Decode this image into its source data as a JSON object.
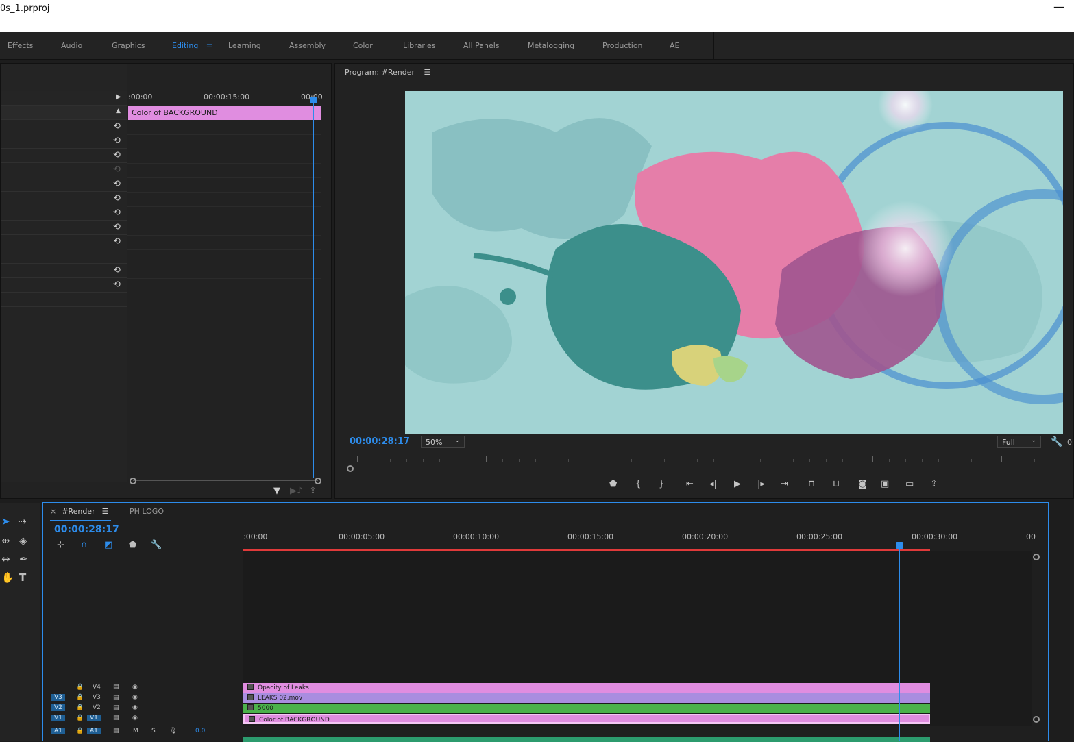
{
  "window": {
    "title": "0s_1.prproj",
    "minimize": "—"
  },
  "workspace_tabs": [
    "Effects",
    "Audio",
    "Graphics",
    "Editing",
    "Learning",
    "Assembly",
    "Color",
    "Libraries",
    "All Panels",
    "Metalogging",
    "Production",
    "AE"
  ],
  "workspace_active": "Editing",
  "effect_controls": {
    "ruler_labels": [
      ":00:00",
      "00:00:15:00",
      "00:00"
    ],
    "clip_label": "Color of BACKGROUND"
  },
  "program_monitor": {
    "title": "Program: #Render",
    "timecode": "00:00:28:17",
    "zoom": "50%",
    "quality": "Full",
    "trailing": "0"
  },
  "timeline": {
    "tabs": [
      {
        "label": "#Render",
        "active": true
      },
      {
        "label": "PH LOGO",
        "active": false
      }
    ],
    "timecode": "00:00:28:17",
    "ruler_labels": [
      ":00:00",
      "00:00:05:00",
      "00:00:10:00",
      "00:00:15:00",
      "00:00:20:00",
      "00:00:25:00",
      "00:00:30:00",
      "00"
    ],
    "tracks": [
      {
        "target": "",
        "name": "V4",
        "clip": "Opacity of Leaks",
        "color": "#e08de0"
      },
      {
        "target": "V3",
        "name": "V3",
        "clip": "LEAKS 02.mov",
        "color": "#a98de0"
      },
      {
        "target": "V2",
        "name": "V2",
        "clip": "5000",
        "color": "#4bb24b"
      },
      {
        "target": "V1",
        "name": "V1",
        "clip": "Color of BACKGROUND",
        "color": "#e08de0"
      }
    ],
    "audio_track": {
      "target": "A1",
      "name": "A1",
      "mute": "M",
      "solo": "S",
      "volume": "0.0"
    }
  }
}
